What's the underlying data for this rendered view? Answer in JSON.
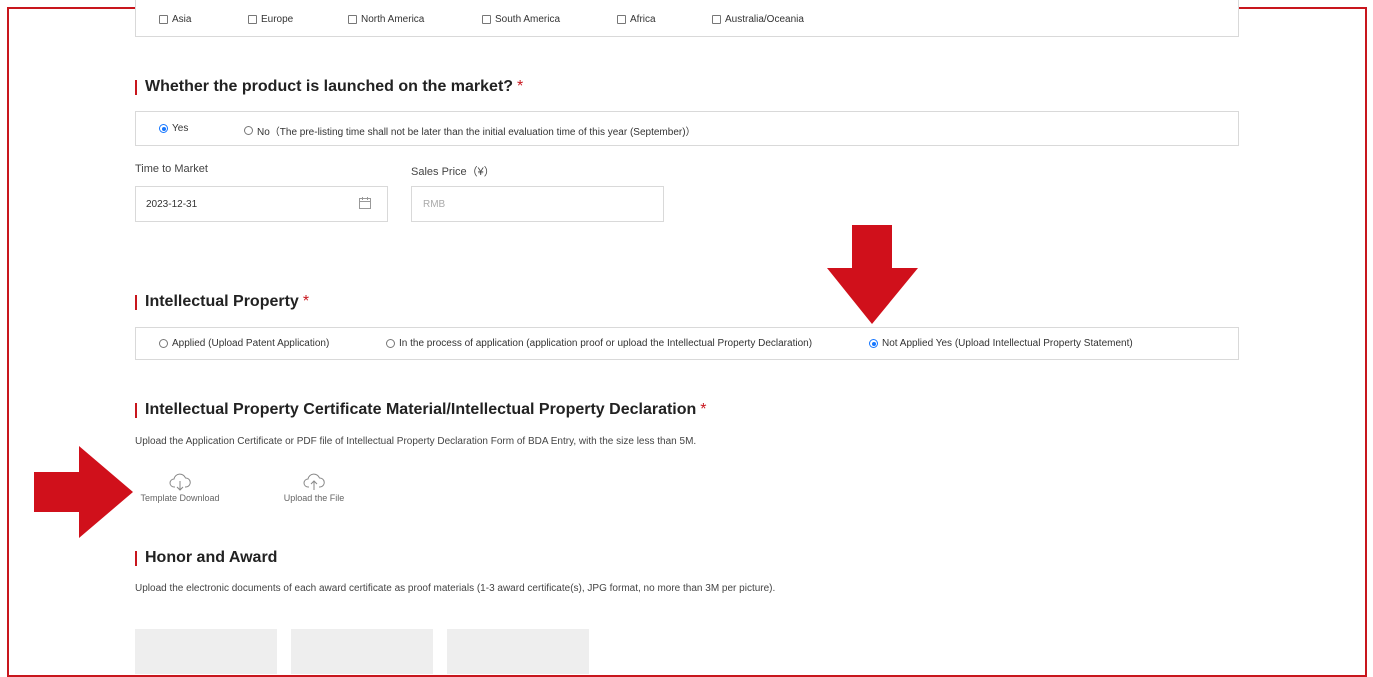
{
  "continents": [
    "Asia",
    "Europe",
    "North America",
    "South America",
    "Africa",
    "Australia/Oceania"
  ],
  "market": {
    "title": "Whether the product is launched on the market?",
    "required_mark": "*",
    "option_yes": "Yes",
    "option_no": "No（The pre-listing time shall not be later than the initial evaluation time of this year (September)）",
    "selected": "Yes"
  },
  "time_to_market": {
    "label": "Time to Market",
    "value": "2023-12-31"
  },
  "sales_price": {
    "label": "Sales Price（¥）",
    "placeholder": "RMB"
  },
  "ip": {
    "title": "Intellectual Property",
    "required_mark": "*",
    "options": [
      "Applied (Upload Patent Application)",
      "In the process of application (application proof or upload the Intellectual Property Declaration)",
      "Not Applied Yes (Upload Intellectual Property Statement)"
    ],
    "selected_index": 2
  },
  "ip_material": {
    "title": "Intellectual Property Certificate Material/Intellectual Property Declaration",
    "required_mark": "*",
    "description": "Upload the Application Certificate or PDF file of Intellectual Property Declaration Form of BDA Entry, with the size less than 5M.",
    "template_download": "Template Download",
    "upload_file": "Upload the File"
  },
  "honor": {
    "title": "Honor and Award",
    "description": "Upload the electronic documents of each award certificate as proof materials (1-3 award certificate(s), JPG format, no more than 3M per picture)."
  },
  "annotation_color": "#d0101b",
  "accent_color": "#1677ff"
}
